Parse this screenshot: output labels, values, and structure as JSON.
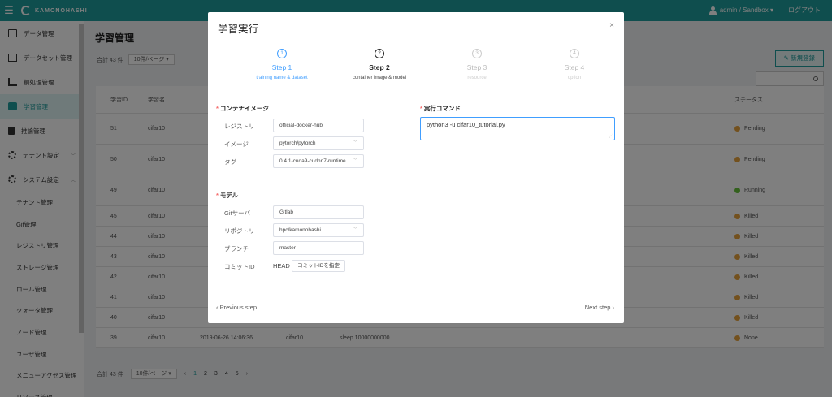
{
  "topbar": {
    "brand": "KAMONOHASHI",
    "user": "admin / Sandbox ▾",
    "logout": "ログアウト"
  },
  "sidebar": {
    "items": [
      {
        "label": "データ管理",
        "icon": "image-icon"
      },
      {
        "label": "データセット管理",
        "icon": "images-icon"
      },
      {
        "label": "前処理管理",
        "icon": "edit-icon"
      },
      {
        "label": "学習管理",
        "icon": "briefcase-icon",
        "active": true
      },
      {
        "label": "推論管理",
        "icon": "document-icon"
      },
      {
        "label": "テナント設定",
        "icon": "gear-icon"
      },
      {
        "label": "システム設定",
        "icon": "gears-icon"
      }
    ],
    "subitems": [
      "テナント管理",
      "Git管理",
      "レジストリ管理",
      "ストレージ管理",
      "ロール管理",
      "クォータ管理",
      "ノード管理",
      "ユーザ管理",
      "メニューアクセス管理",
      "リソース管理"
    ]
  },
  "main": {
    "title": "学習管理",
    "total": "合計 43 件",
    "per_page": "10件/ページ ▾",
    "new_button": "✎ 新規登録",
    "headers": {
      "id": "学習ID",
      "name": "学習名",
      "status": "ステータス"
    },
    "rows": [
      {
        "id": "51",
        "name": "cifar10",
        "date": "",
        "data": "",
        "cmd": "",
        "status": "Pending",
        "color": "#e6a23c"
      },
      {
        "id": "50",
        "name": "cifar10",
        "date": "",
        "data": "",
        "cmd": "",
        "status": "Pending",
        "color": "#e6a23c"
      },
      {
        "id": "49",
        "name": "cifar10",
        "date": "",
        "data": "",
        "cmd": "",
        "status": "Running",
        "color": "#67c23a"
      },
      {
        "id": "45",
        "name": "cifar10",
        "date": "",
        "data": "",
        "cmd": "",
        "status": "Killed",
        "color": "#e6a23c"
      },
      {
        "id": "44",
        "name": "cifar10",
        "date": "",
        "data": "",
        "cmd": "",
        "status": "Killed",
        "color": "#e6a23c"
      },
      {
        "id": "43",
        "name": "cifar10",
        "date": "",
        "data": "",
        "cmd": "",
        "status": "Killed",
        "color": "#e6a23c"
      },
      {
        "id": "42",
        "name": "cifar10",
        "date": "",
        "data": "",
        "cmd": "",
        "status": "Killed",
        "color": "#e6a23c"
      },
      {
        "id": "41",
        "name": "cifar10",
        "date": "",
        "data": "",
        "cmd": "",
        "status": "Killed",
        "color": "#e6a23c"
      },
      {
        "id": "40",
        "name": "cifar10",
        "date": "",
        "data": "",
        "cmd": "",
        "status": "Killed",
        "color": "#e6a23c"
      },
      {
        "id": "39",
        "name": "cifar10",
        "date": "2019-06-26 14:06:36",
        "data": "cifar10",
        "cmd": "sleep 10000000000",
        "status": "None",
        "color": "#e6a23c"
      }
    ],
    "pager": {
      "total": "合計 43 件",
      "per_page": "10件/ページ ▾",
      "prev": "‹",
      "next": "›",
      "pages": [
        "1",
        "2",
        "3",
        "4",
        "5"
      ]
    }
  },
  "modal": {
    "title": "学習実行",
    "close": "×",
    "steps": [
      {
        "num": "1",
        "title": "Step 1",
        "desc": "training name & dataset",
        "state": "done"
      },
      {
        "num": "2",
        "title": "Step 2",
        "desc": "container image & model",
        "state": "current"
      },
      {
        "num": "3",
        "title": "Step 3",
        "desc": "resource",
        "state": "todo"
      },
      {
        "num": "4",
        "title": "Step 4",
        "desc": "option",
        "state": "todo"
      }
    ],
    "container": {
      "section": "コンテナイメージ",
      "registry_label": "レジストリ",
      "registry": "official-docker-hub",
      "image_label": "イメージ",
      "image": "pytorch/pytorch",
      "tag_label": "タグ",
      "tag": "0.4.1-cuda9-cudnn7-runtime"
    },
    "command": {
      "section": "実行コマンド",
      "value": "python3 -u cifar10_tutorial.py"
    },
    "model": {
      "section": "モデル",
      "git_label": "Gitサーバ",
      "git": "Gitlab",
      "repo_label": "リポジトリ",
      "repo": "hpc/kamonohashi",
      "branch_label": "ブランチ",
      "branch": "master",
      "commit_label": "コミットID",
      "commit": "HEAD",
      "commit_button": "コミットIDを指定"
    },
    "prev": "‹  Previous step",
    "next": "Next step  ›"
  }
}
